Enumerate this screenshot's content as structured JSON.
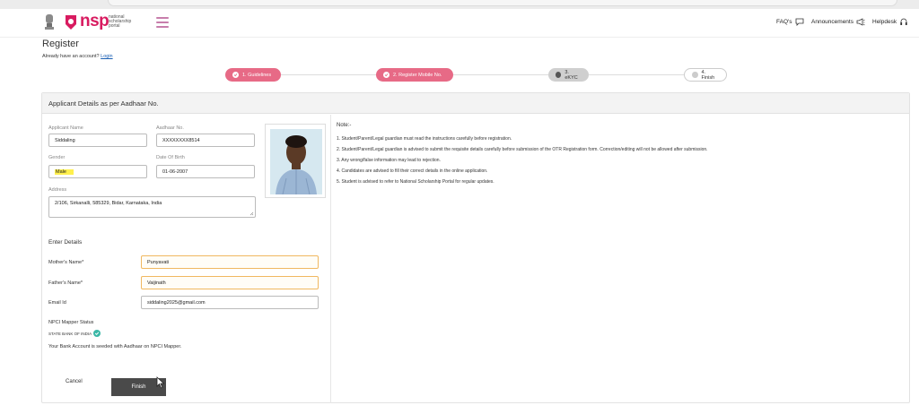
{
  "header": {
    "logo_text": "nsp",
    "logo_subtext": "national scholarship portal",
    "links": {
      "faqs": "FAQ's",
      "announcements": "Announcements",
      "helpdesk": "Helpdesk"
    }
  },
  "page": {
    "title": "Register",
    "account_prompt": "Already have an account?",
    "login_link": "Login"
  },
  "stepper": {
    "steps": [
      {
        "label": "1. Guidelines",
        "state": "done"
      },
      {
        "label": "2. Register Mobile No.",
        "state": "done"
      },
      {
        "label": "3. eKYC",
        "state": "current"
      },
      {
        "label": "4. Finish",
        "state": "pending"
      }
    ]
  },
  "applicant": {
    "card_title": "Applicant Details as per Aadhaar No.",
    "name_label": "Applicant Name",
    "name_value": "Siddaling",
    "aadhaar_label": "Aadhaar No.",
    "aadhaar_value": "XXXXXXXX8514",
    "gender_label": "Gender",
    "gender_value": "Male",
    "dob_label": "Date Of Birth",
    "dob_value": "01-06-2007",
    "address_label": "Address",
    "address_value": "2/106, Sirkanalli, 585329, Bidar, Karnataka, India"
  },
  "details": {
    "section_title": "Enter Details",
    "mother_label": "Mother's Name*",
    "mother_value": "Punyavati",
    "father_label": "Father's Name*",
    "father_value": "Vaijinath",
    "email_label": "Email Id",
    "email_value": "siddaling2025@gmail.com"
  },
  "npci": {
    "title": "NPCI Mapper Status",
    "bank": "STATE BANK OF INDIA",
    "message": "Your Bank Account is seeded with Aadhaar on NPCI Mapper."
  },
  "actions": {
    "cancel": "Cancel",
    "finish": "Finish"
  },
  "notes": {
    "title": "Note:-",
    "items": [
      "1. Student/Parent/Legal guardian must read the instructions carefully before registration.",
      "2. Student/Parent/Legal guardian is advised to submit the requisite details carefully before submission of the OTR Registration form. Correction/editing will not be allowed after submission.",
      "3. Any wrong/false information may lead to rejection.",
      "4. Candidates are advised to fill their correct details in the online application.",
      "5. Student is advised to refer to National Scholarship Portal for regular updates."
    ]
  },
  "colors": {
    "brand": "#d81b60",
    "step_done": "#e76a86",
    "step_current": "#cfcfcf",
    "highlight": "#fff04d",
    "required_field_border": "#f0b860",
    "verified": "#3bb8a7",
    "finish_button": "#4a4a4a"
  }
}
